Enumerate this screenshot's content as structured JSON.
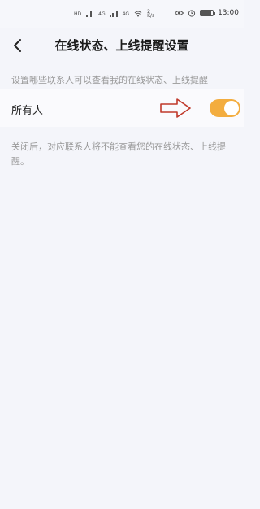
{
  "status_bar": {
    "net_left": "HD",
    "sig1": "4G",
    "sig2": "4G",
    "speed": "2\nK/s",
    "time": "13:00"
  },
  "header": {
    "title": "在线状态、上线提醒设置"
  },
  "hint": "设置哪些联系人可以查看我的在线状态、上线提醒",
  "row": {
    "label": "所有人",
    "toggle_on": true
  },
  "note": "关闭后，对应联系人将不能查看您的在线状态、上线提醒。",
  "colors": {
    "toggle": "#f3ad3f",
    "arrow": "#c0392b",
    "background": "#f4f5fa"
  }
}
